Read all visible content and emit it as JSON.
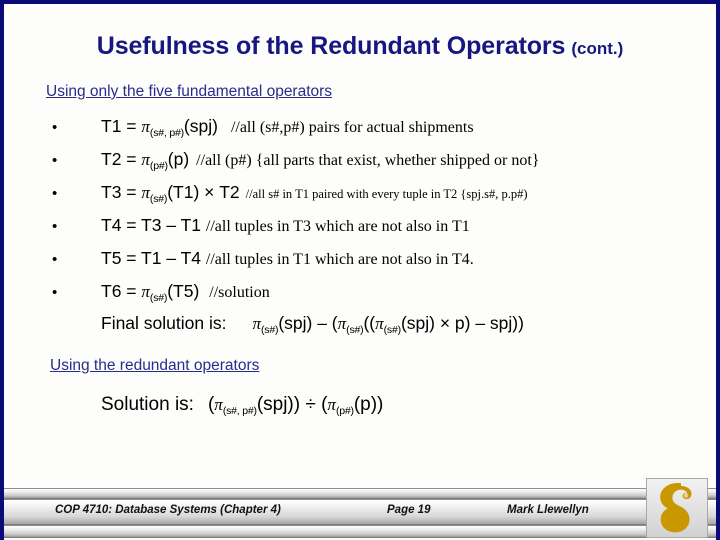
{
  "slide": {
    "title_main": "Usefulness of the Redundant Operators",
    "title_cont": "(cont.)",
    "title_color": "#17177f",
    "border_color": "#0a0a78",
    "background": "#fdfdfb"
  },
  "sections": {
    "fundamental_heading": "Using only the five fundamental operators",
    "redundant_heading": "Using the redundant operators",
    "heading_color": "#2b2b8c"
  },
  "bullets": [
    {
      "marker": "•",
      "lhs": "T1 = ",
      "pi": "π",
      "subscript": "(s#, p#)",
      "arg": "(spj)",
      "comment": "//all (s#,p#) pairs for actual shipments",
      "comment_size": "normal"
    },
    {
      "marker": "•",
      "lhs": "T2 = ",
      "pi": "π",
      "subscript": "(p#)",
      "arg": "(p)",
      "comment": "//all (p#)  {all parts that exist, whether shipped or not}",
      "comment_size": "normal"
    },
    {
      "marker": "•",
      "lhs": "T3 = ",
      "pi": "π",
      "subscript": "(s#)",
      "arg": "(T1) × T2",
      "comment": "//all s# in T1 paired with every tuple in T2  {spj.s#, p.p#)",
      "comment_size": "small"
    },
    {
      "marker": "•",
      "lhs": "T4 = T3 – T1 ",
      "pi": "",
      "subscript": "",
      "arg": "",
      "comment": "//all tuples in T3 which are not also in T1",
      "comment_size": "normal"
    },
    {
      "marker": "•",
      "lhs": "T5 = T1 – T4 ",
      "pi": "",
      "subscript": "",
      "arg": "",
      "comment": "//all tuples in T1 which are not also in T4.",
      "comment_size": "normal"
    },
    {
      "marker": "•",
      "lhs": "T6 = ",
      "pi": "π",
      "subscript": "(s#)",
      "arg": "(T5)",
      "comment": "//solution",
      "comment_size": "normal"
    }
  ],
  "final_solution": {
    "label": "Final solution is:",
    "pi": "π",
    "sub1": "(s#)",
    "part1": "(spj) – (",
    "sub2": "(s#)",
    "part2": "((",
    "sub3": "(s#)",
    "part3": "(spj) × p) – spj))"
  },
  "redundant_solution": {
    "label": "Solution is:",
    "open": "(",
    "pi": "π",
    "sub1": "(s#, p#)",
    "mid": "(spj)) ÷ (",
    "sub2": "(p#)",
    "close": "(p))"
  },
  "footer": {
    "course": "COP 4710: Database Systems  (Chapter 4)",
    "page": "Page 19",
    "author": "Mark Llewellyn",
    "logo_name": "ucf-pegasus-logo",
    "logo_color": "#c99700"
  }
}
